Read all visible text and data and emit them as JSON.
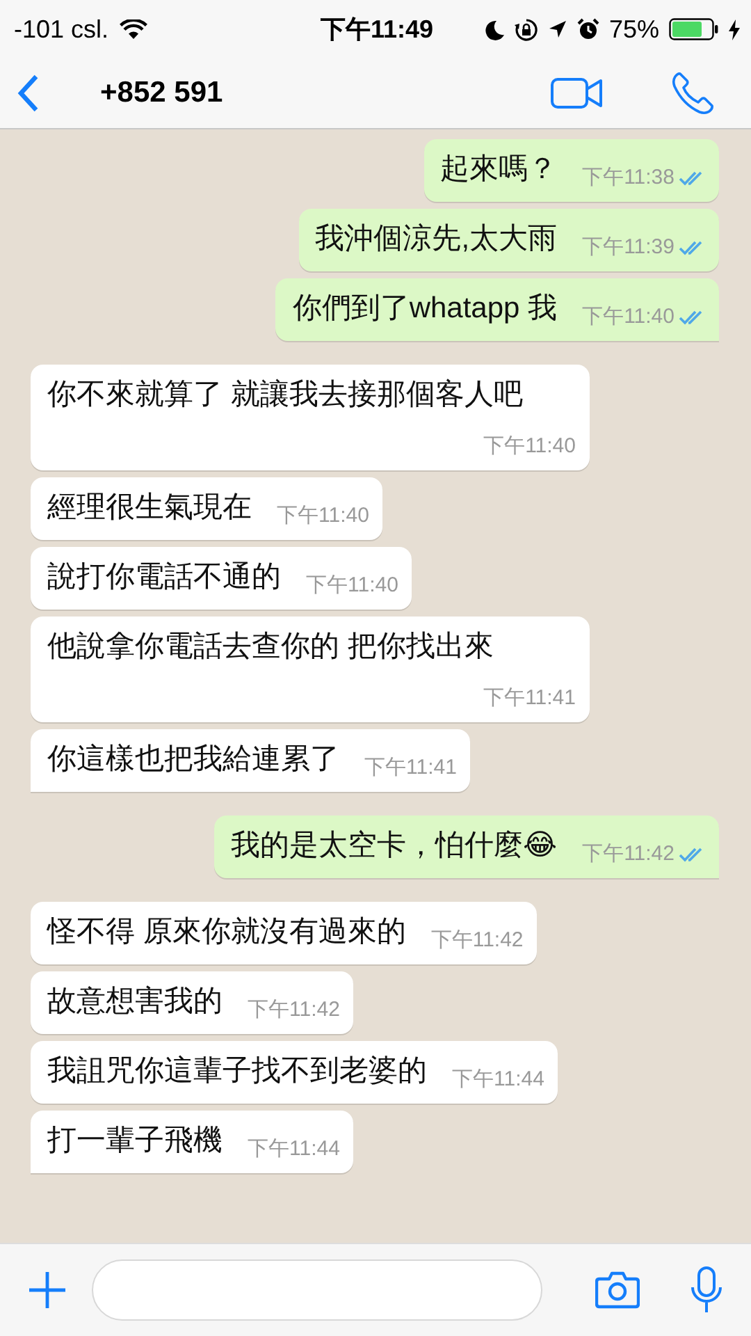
{
  "status_bar": {
    "carrier": "-101 csl.",
    "time": "下午11:49",
    "battery": "75%"
  },
  "header": {
    "contact": "+852 591"
  },
  "messages": [
    {
      "kind": "out",
      "text": "起來嗎？",
      "time": "下午11:38",
      "read": true,
      "tail": false
    },
    {
      "kind": "out",
      "text": "我沖個涼先,太大雨",
      "time": "下午11:39",
      "read": true,
      "tail": false
    },
    {
      "kind": "out",
      "text": "你們到了whatapp 我",
      "time": "下午11:40",
      "read": true,
      "tail": true
    },
    {
      "kind": "in",
      "text": "你不來就算了  就讓我去接那個客人吧",
      "time": "下午11:40",
      "tail": false
    },
    {
      "kind": "in",
      "text": "經理很生氣現在",
      "time": "下午11:40",
      "tail": false
    },
    {
      "kind": "in",
      "text": "說打你電話不通的",
      "time": "下午11:40",
      "tail": false
    },
    {
      "kind": "in",
      "text": "他說拿你電話去查你的  把你找出來",
      "time": "下午11:41",
      "tail": false
    },
    {
      "kind": "in",
      "text": "你這樣也把我給連累了",
      "time": "下午11:41",
      "tail": true
    },
    {
      "kind": "out",
      "text": "我的是太空卡，怕什麼😂",
      "time": "下午11:42",
      "read": true,
      "tail": true
    },
    {
      "kind": "in",
      "text": "怪不得 原來你就沒有過來的",
      "time": "下午11:42",
      "tail": false
    },
    {
      "kind": "in",
      "text": "故意想害我的",
      "time": "下午11:42",
      "tail": false
    },
    {
      "kind": "in",
      "text": "我詛咒你這輩子找不到老婆的",
      "time": "下午11:44",
      "tail": false
    },
    {
      "kind": "in",
      "text": "打一輩子飛機",
      "time": "下午11:44",
      "tail": true
    }
  ]
}
